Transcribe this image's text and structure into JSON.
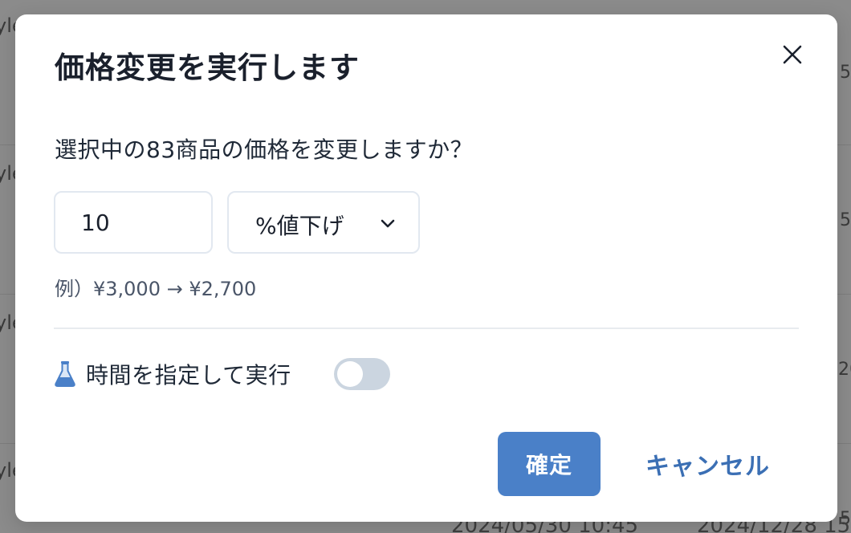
{
  "background": {
    "left_fragments": [
      "yle",
      "yle",
      "yle",
      "yle"
    ],
    "right_fragments": [
      "5",
      "5",
      "20",
      "5"
    ],
    "bottom_left_text": "2024/05/30 10:45",
    "bottom_right_text": "2024/12/28 15"
  },
  "modal": {
    "title": "価格変更を実行します",
    "question": "選択中の83商品の価格を変更しますか？",
    "amount_value": "10",
    "change_type": {
      "selected": "%値下げ"
    },
    "example": "例）¥3,000 → ¥2,700",
    "schedule": {
      "label": "時間を指定して実行",
      "enabled": false
    },
    "confirm_label": "確定",
    "cancel_label": "キャンセル"
  },
  "colors": {
    "primary": "#4a80c8",
    "cancel_text": "#3b6fb4",
    "flask_icon": "#4a80c8",
    "toggle_off": "#cbd5e0"
  },
  "icons": {
    "close": "close-icon",
    "chevron": "chevron-down-icon",
    "flask": "flask-icon"
  }
}
